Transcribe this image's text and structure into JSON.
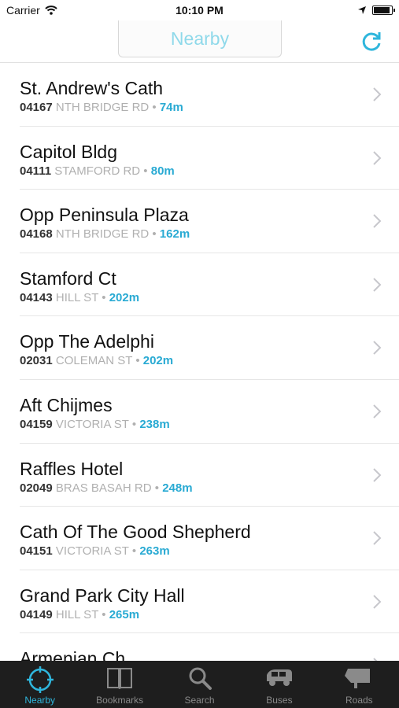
{
  "status": {
    "carrier": "Carrier",
    "time": "10:10 PM"
  },
  "nav": {
    "title": "Nearby"
  },
  "stops": [
    {
      "name": "St. Andrew's Cath",
      "code": "04167",
      "road": "NTH BRIDGE RD",
      "distance": "74m"
    },
    {
      "name": "Capitol Bldg",
      "code": "04111",
      "road": "STAMFORD RD",
      "distance": "80m"
    },
    {
      "name": "Opp Peninsula Plaza",
      "code": "04168",
      "road": "NTH BRIDGE RD",
      "distance": "162m"
    },
    {
      "name": "Stamford Ct",
      "code": "04143",
      "road": "HILL ST",
      "distance": "202m"
    },
    {
      "name": "Opp The Adelphi",
      "code": "02031",
      "road": "COLEMAN ST",
      "distance": "202m"
    },
    {
      "name": "Aft Chijmes",
      "code": "04159",
      "road": "VICTORIA ST",
      "distance": "238m"
    },
    {
      "name": "Raffles Hotel",
      "code": "02049",
      "road": "BRAS BASAH RD",
      "distance": "248m"
    },
    {
      "name": "Cath Of The Good Shepherd",
      "code": "04151",
      "road": "VICTORIA ST",
      "distance": "263m"
    },
    {
      "name": "Grand Park City Hall",
      "code": "04149",
      "road": "HILL ST",
      "distance": "265m"
    },
    {
      "name": "Armenian Ch",
      "code": "",
      "road": "",
      "distance": ""
    }
  ],
  "separator": "•",
  "tabs": [
    {
      "label": "Nearby",
      "icon": "crosshair-icon",
      "active": true
    },
    {
      "label": "Bookmarks",
      "icon": "book-icon",
      "active": false
    },
    {
      "label": "Search",
      "icon": "magnifier-icon",
      "active": false
    },
    {
      "label": "Buses",
      "icon": "bus-icon",
      "active": false
    },
    {
      "label": "Roads",
      "icon": "road-sign-icon",
      "active": false
    }
  ],
  "colors": {
    "accent": "#2fb6dc",
    "distance": "#29aad3",
    "navTitle": "#8fd9ea",
    "tabBar": "#1e1e1e"
  }
}
